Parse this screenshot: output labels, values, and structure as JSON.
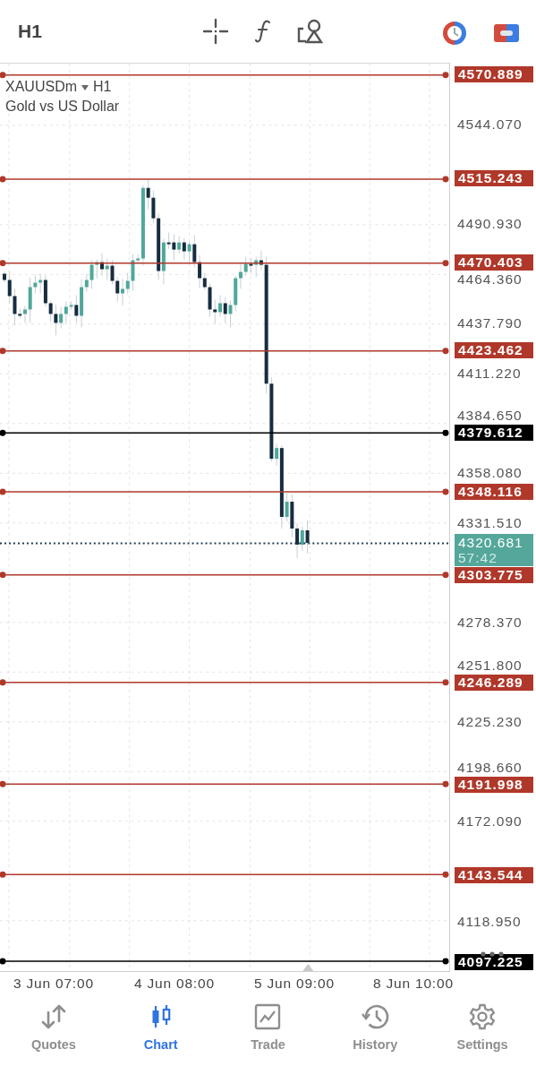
{
  "toolbar": {
    "timeframe": "H1"
  },
  "symbol": {
    "name": "XAUUSDm",
    "timeframe": "H1",
    "description": "Gold vs US Dollar"
  },
  "price_axis": {
    "ticks": [
      "4544.070",
      "4490.930",
      "4464.360",
      "4437.790",
      "4411.220",
      "4384.650",
      "4358.080",
      "4331.510",
      "4278.370",
      "4251.800",
      "4225.230",
      "4198.660",
      "4172.090",
      "4118.950"
    ]
  },
  "levels": [
    {
      "price": "4570.889",
      "color": "#b0382a"
    },
    {
      "price": "4515.243",
      "color": "#b0382a"
    },
    {
      "price": "4470.403",
      "color": "#b0382a"
    },
    {
      "price": "4423.462",
      "color": "#b0382a"
    },
    {
      "price": "4379.612",
      "color": "#000000"
    },
    {
      "price": "4348.116",
      "color": "#b0382a"
    },
    {
      "price": "4303.775",
      "color": "#b0382a"
    },
    {
      "price": "4246.289",
      "color": "#b0382a"
    },
    {
      "price": "4191.998",
      "color": "#b0382a"
    },
    {
      "price": "4143.544",
      "color": "#b0382a"
    },
    {
      "price": "4097.225",
      "color": "#000000"
    }
  ],
  "current_price": {
    "price": "4320.681",
    "countdown": "57:42"
  },
  "time_axis": {
    "labels": [
      "3 Jun 07:00",
      "4 Jun 08:00",
      "5 Jun 09:00",
      "8 Jun 10:00"
    ]
  },
  "tabs": [
    {
      "label": "Quotes",
      "kind": "quotes",
      "selected": false
    },
    {
      "label": "Chart",
      "kind": "chart",
      "selected": true
    },
    {
      "label": "Trade",
      "kind": "trade",
      "selected": false
    },
    {
      "label": "History",
      "kind": "history",
      "selected": false
    },
    {
      "label": "Settings",
      "kind": "settings",
      "selected": false
    }
  ]
}
